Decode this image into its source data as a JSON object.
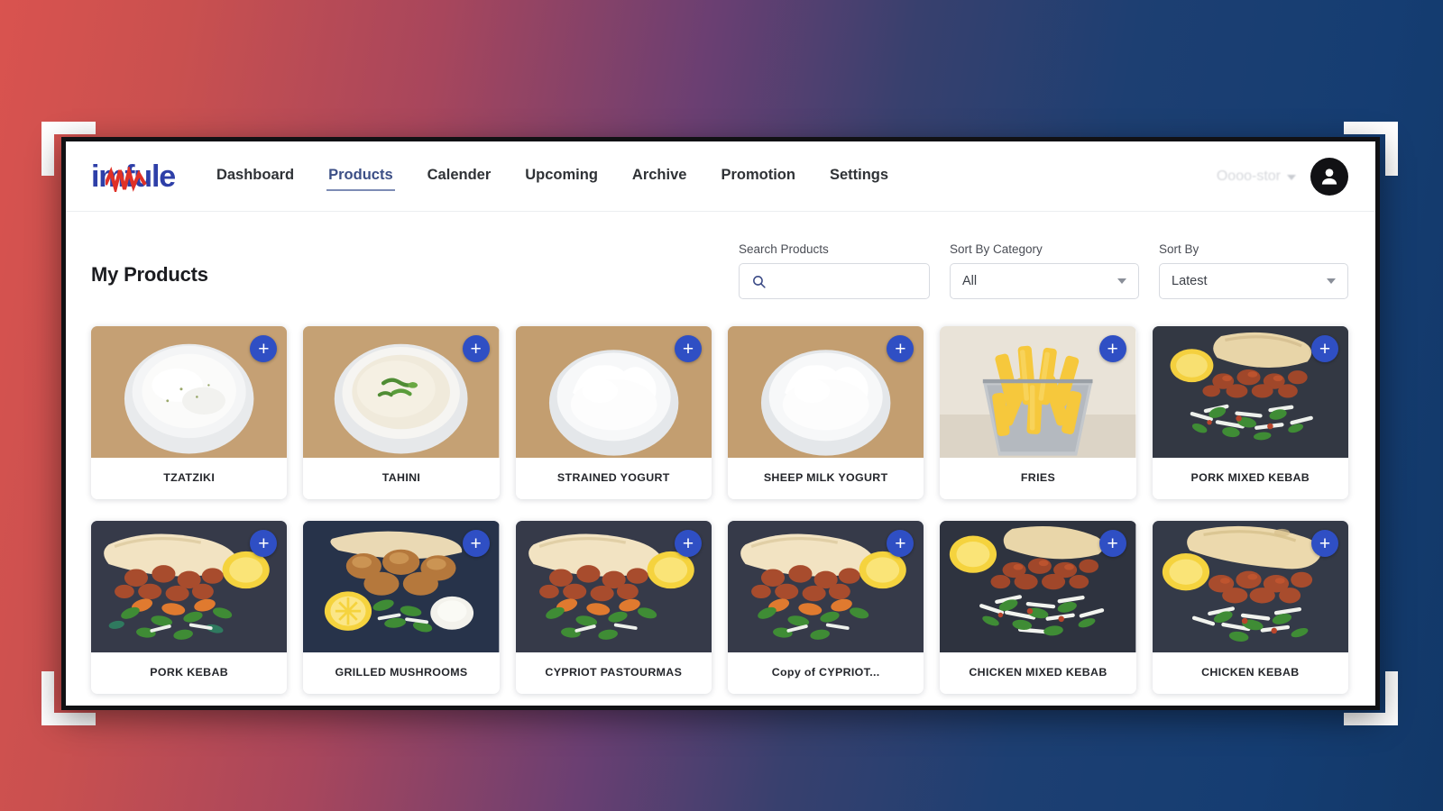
{
  "theme": {
    "background_gradient_start": "#d9534f",
    "background_gradient_end": "#153d72",
    "accent_blue": "#2f4fc4",
    "logo_blue": "#2e3fa8",
    "logo_red": "#e03127",
    "bracket_color": "#ffffff",
    "window_frame": "#111114"
  },
  "header": {
    "logo_text": "imfule",
    "nav": [
      {
        "label": "Dashboard",
        "active": false
      },
      {
        "label": "Products",
        "active": true
      },
      {
        "label": "Calender",
        "active": false
      },
      {
        "label": "Upcoming",
        "active": false
      },
      {
        "label": "Archive",
        "active": false
      },
      {
        "label": "Promotion",
        "active": false
      },
      {
        "label": "Settings",
        "active": false
      }
    ],
    "user_name": "Oooo-stor",
    "user_chevron_icon": "chevron-down-icon",
    "avatar_icon": "user-avatar-icon"
  },
  "main": {
    "page_title": "My Products",
    "filters": {
      "search": {
        "label": "Search Products",
        "value": "",
        "placeholder": "",
        "icon": "search-icon"
      },
      "category": {
        "label": "Sort By Category",
        "value": "All",
        "options": [
          "All"
        ],
        "icon": "chevron-down-icon"
      },
      "sort": {
        "label": "Sort By",
        "value": "Latest",
        "options": [
          "Latest"
        ],
        "icon": "chevron-down-icon"
      }
    },
    "add_button_label": "+",
    "products": [
      {
        "name": "TZATZIKI",
        "image": "bowl-white-dip"
      },
      {
        "name": "TAHINI",
        "image": "bowl-tahini-herbs"
      },
      {
        "name": "STRAINED YOGURT",
        "image": "bowl-yogurt"
      },
      {
        "name": "SHEEP MILK YOGURT",
        "image": "bowl-yogurt"
      },
      {
        "name": "FRIES",
        "image": "fries-basket"
      },
      {
        "name": "PORK MIXED KEBAB",
        "image": "kebab-platter"
      },
      {
        "name": "PORK KEBAB",
        "image": "pita-kebab-lemon"
      },
      {
        "name": "GRILLED MUSHROOMS",
        "image": "mushrooms-platter"
      },
      {
        "name": "CYPRIOT PASTOURMAS",
        "image": "pita-kebab-lemon"
      },
      {
        "name": "Copy of CYPRIOT...",
        "image": "pita-kebab-lemon"
      },
      {
        "name": "CHICKEN MIXED KEBAB",
        "image": "kebab-platter"
      },
      {
        "name": "CHICKEN KEBAB",
        "image": "pita-wrap-platter"
      }
    ]
  }
}
